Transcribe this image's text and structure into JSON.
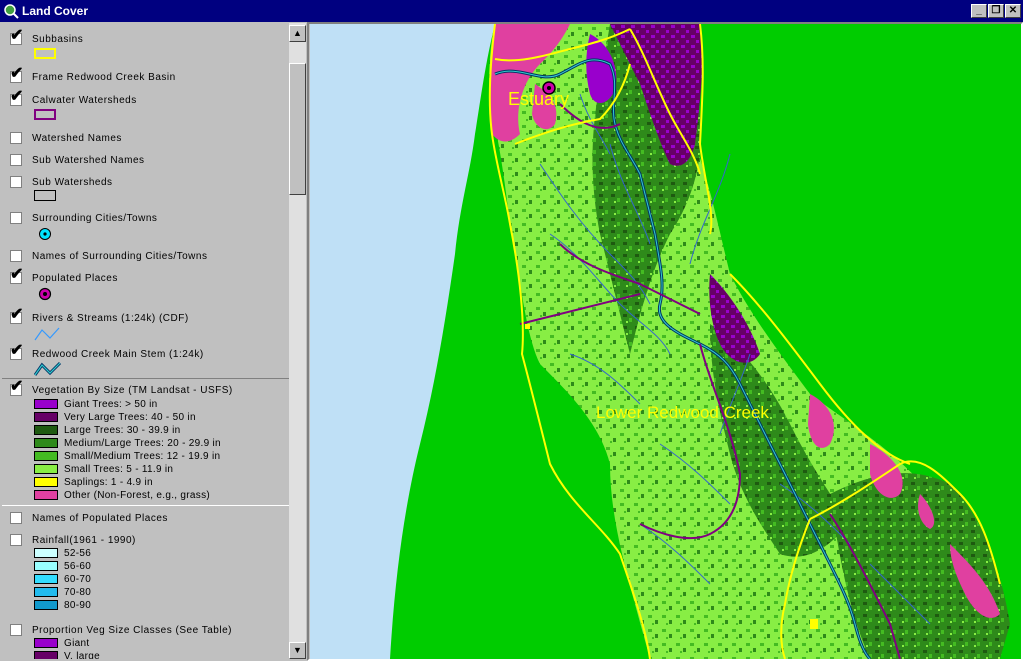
{
  "window": {
    "title": "Land Cover",
    "buttons": {
      "minimize": "_",
      "restore": "❐",
      "close": "✕"
    }
  },
  "colors": {
    "titlebar": "#000080",
    "ocean": "#bfe0f6",
    "grass_background": "#00cc00",
    "subbasin_outline": "#ffff00",
    "watershed_outline": "#800080",
    "streams": "#3366cc"
  },
  "layers": [
    {
      "label": "Subbasins",
      "checked": true,
      "symbol": "yellow-rect"
    },
    {
      "label": "Frame Redwood Creek Basin",
      "checked": true
    },
    {
      "label": "Calwater Watersheds",
      "checked": true,
      "symbol": "purple-rect"
    },
    {
      "label": "Watershed Names",
      "checked": false
    },
    {
      "label": "Sub Watershed Names",
      "checked": false
    },
    {
      "label": "Sub Watersheds",
      "checked": false,
      "symbol": "gray-rect"
    },
    {
      "label": "Surrounding Cities/Towns",
      "checked": false,
      "symbol": "cyan-dot"
    },
    {
      "label": "Names of Surrounding Cities/Towns",
      "checked": false
    },
    {
      "label": "Populated Places",
      "checked": true,
      "symbol": "purple-dot"
    },
    {
      "label": "Rivers & Streams (1:24k) (CDF)",
      "checked": true,
      "symbol": "blue-line"
    },
    {
      "label": "Redwood Creek Main Stem (1:24k)",
      "checked": true,
      "symbol": "teal-line"
    },
    {
      "label": "Vegetation By Size (TM Landsat - USFS)",
      "checked": true
    },
    {
      "label": "Names of Populated Places",
      "checked": false
    },
    {
      "label": "Rainfall(1961 - 1990)",
      "checked": false
    },
    {
      "label": "Proportion Veg Size Classes (See Table)",
      "checked": false
    }
  ],
  "vegetation_legend": [
    {
      "label": "Giant Trees: > 50 in",
      "color": "#9900cc"
    },
    {
      "label": "Very Large Trees: 40 - 50 in",
      "color": "#660066"
    },
    {
      "label": "Large Trees: 30 - 39.9 in",
      "color": "#1e5a10"
    },
    {
      "label": "Medium/Large Trees: 20 - 29.9 in",
      "color": "#2e8a1a"
    },
    {
      "label": "Small/Medium Trees: 12 - 19.9 in",
      "color": "#44bb22"
    },
    {
      "label": "Small Trees: 5 - 11.9 in",
      "color": "#88ee44"
    },
    {
      "label": "Saplings: 1 - 4.9 in",
      "color": "#ffff00"
    },
    {
      "label": "Other (Non-Forest, e.g., grass)",
      "color": "#e040a0"
    }
  ],
  "rainfall_legend": [
    {
      "label": "52-56",
      "color": "#ccffff"
    },
    {
      "label": "56-60",
      "color": "#99ffff"
    },
    {
      "label": "60-70",
      "color": "#33ddff"
    },
    {
      "label": "70-80",
      "color": "#22bbee"
    },
    {
      "label": "80-90",
      "color": "#1199cc"
    }
  ],
  "proportion_legend": [
    {
      "label": "Giant",
      "color": "#9900cc"
    },
    {
      "label": "V. large",
      "color": "#660066"
    }
  ],
  "map_labels": {
    "estuary": "Estuary",
    "lower_redwood_creek": "Lower Redwood Creek"
  }
}
